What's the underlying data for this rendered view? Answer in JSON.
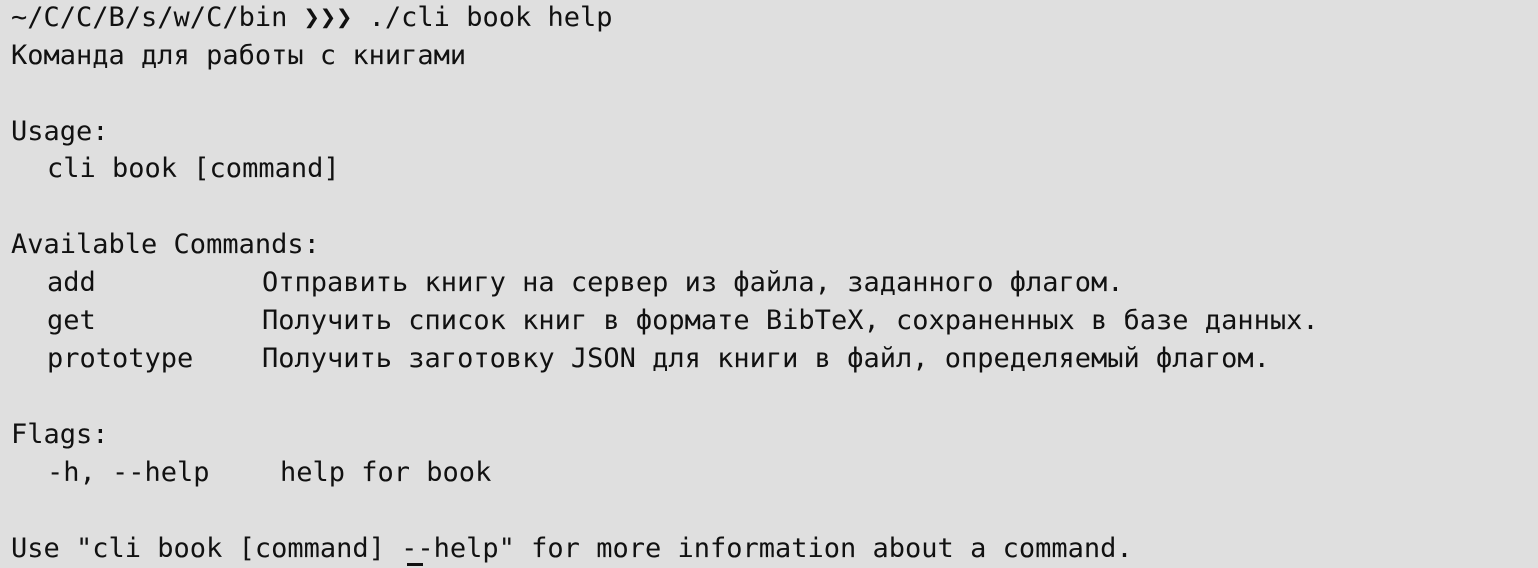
{
  "prompt": {
    "path": "~/C/C/B/s/w/C/bin",
    "arrows": "❯❯❯",
    "command": "./cli book help"
  },
  "description": "Команда для работы с книгами",
  "usage": {
    "heading": "Usage:",
    "line": "cli book [command]"
  },
  "commands": {
    "heading": "Available Commands:",
    "items": [
      {
        "name": "add",
        "description": "Отправить книгу на сервер из файла, заданного флагом."
      },
      {
        "name": "get",
        "description": "Получить список книг в формате BibTeX, сохраненных в базе данных."
      },
      {
        "name": "prototype",
        "description": "Получить заготовку JSON для книги в файл, определяемый флагом."
      }
    ]
  },
  "flags": {
    "heading": "Flags:",
    "items": [
      {
        "name": "-h, --help",
        "description": "help for book"
      }
    ]
  },
  "footer": "Use \"cli book [command] --help\" for more information about a command.",
  "colors": {
    "background": "#dfdfdf",
    "text": "#111111"
  }
}
